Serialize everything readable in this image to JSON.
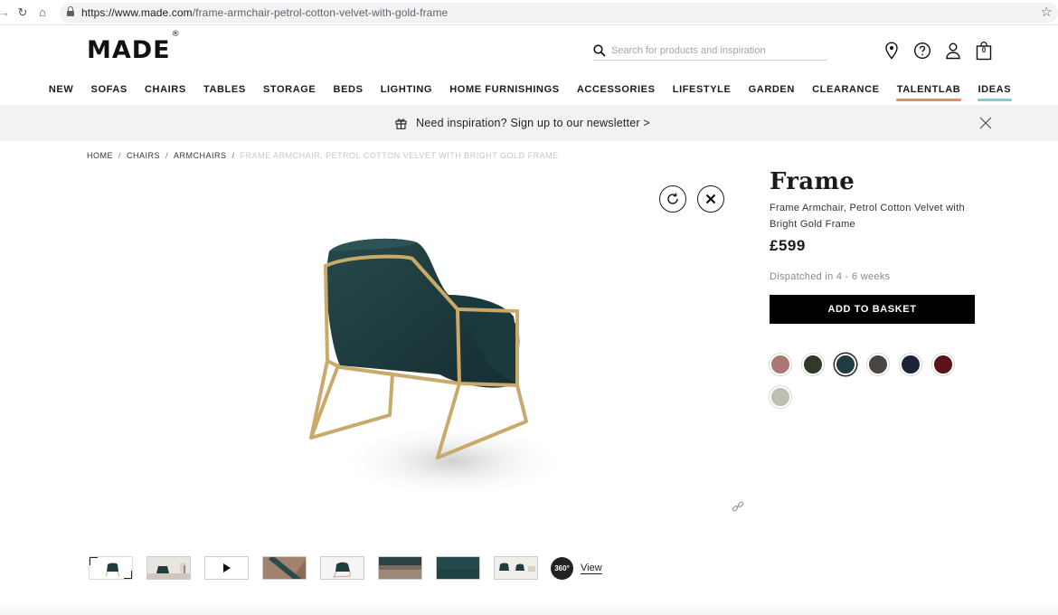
{
  "browser": {
    "url_host": "https://www.made.com",
    "url_path": "/frame-armchair-petrol-cotton-velvet-with-gold-frame"
  },
  "header": {
    "logo": "MADE",
    "logo_mark": "®",
    "search_placeholder": "Search for products and inspiration",
    "icons": [
      "location-pin-icon",
      "help-icon",
      "account-icon",
      "basket-icon"
    ],
    "basket_count": "0"
  },
  "nav": {
    "items": [
      {
        "label": "NEW"
      },
      {
        "label": "SOFAS"
      },
      {
        "label": "CHAIRS"
      },
      {
        "label": "TABLES"
      },
      {
        "label": "STORAGE"
      },
      {
        "label": "BEDS"
      },
      {
        "label": "LIGHTING"
      },
      {
        "label": "HOME FURNISHINGS"
      },
      {
        "label": "ACCESSORIES"
      },
      {
        "label": "LIFESTYLE"
      },
      {
        "label": "GARDEN"
      },
      {
        "label": "CLEARANCE"
      },
      {
        "label": "TALENTLAB",
        "underline": "#e8866f"
      },
      {
        "label": "IDEAS",
        "underline": "#8ec5cf"
      }
    ]
  },
  "newsletter": {
    "text": "Need inspiration? Sign up to our newsletter >"
  },
  "breadcrumb": {
    "items": [
      "HOME",
      "CHAIRS",
      "ARMCHAIRS"
    ],
    "current": "FRAME ARMCHAIR, PETROL COTTON VELVET WITH BRIGHT GOLD FRAME"
  },
  "viewer": {
    "thumbnail_count": 8,
    "view360_badge": "360°",
    "view360_label": "View"
  },
  "product": {
    "title": "Frame",
    "subtitle": "Frame Armchair, Petrol Cotton Velvet with Bright Gold Frame",
    "price": "£599",
    "dispatch": "Dispatched in 4 - 6 weeks",
    "add_to_basket": "ADD TO BASKET",
    "swatches": [
      {
        "color": "#a87977",
        "selected": false
      },
      {
        "color": "#2f3a27",
        "selected": false
      },
      {
        "color": "#213b42",
        "selected": true
      },
      {
        "color": "#4a4740",
        "selected": false
      },
      {
        "color": "#1a2436",
        "selected": false
      },
      {
        "color": "#5a1418",
        "selected": false
      },
      {
        "color": "#bfbeb0",
        "selected": false
      }
    ]
  },
  "colors": {
    "accent": "#000000",
    "velvet": "#1f3d3f",
    "frame_gold": "#c9aa6a"
  }
}
